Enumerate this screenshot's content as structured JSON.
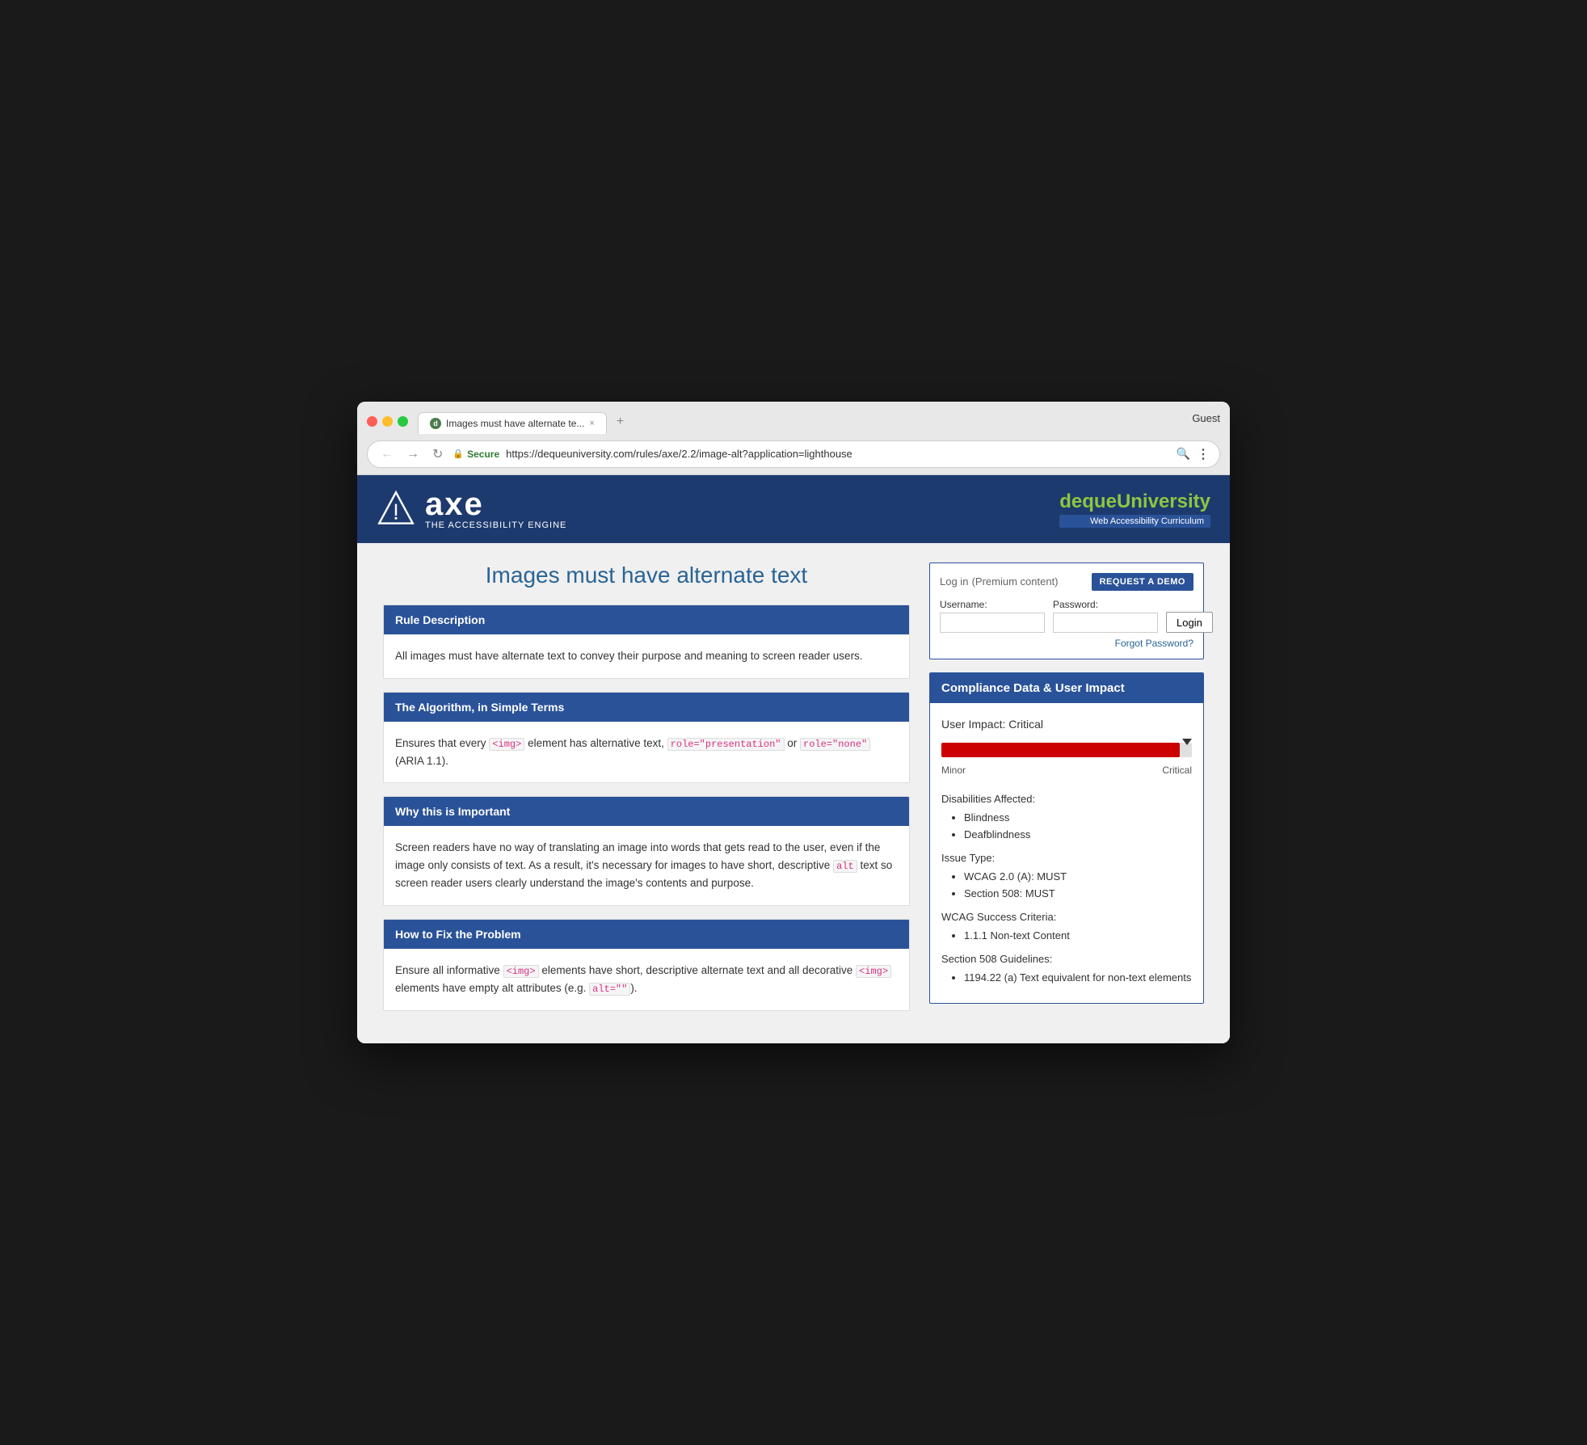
{
  "browser": {
    "tab_label": "Images must have alternate te...",
    "tab_favicon": "d",
    "guest_label": "Guest",
    "address_secure": "Secure",
    "address_url_full": "https://dequeuniversity.com/rules/axe/2.2/image-alt?application=lighthouse",
    "address_url_base": "https://dequeuniversity.com",
    "address_url_path": "/rules/axe/2.2/image-alt?application=lighthouse"
  },
  "header": {
    "axe_title": "axe",
    "axe_subtitle": "THE ACCESSIBILITY ENGINE",
    "deque_name_part1": "deque",
    "deque_name_part2": "University",
    "deque_tagline": "Web Accessibility Curriculum"
  },
  "page": {
    "title": "Images must have alternate text"
  },
  "login": {
    "title": "Log in",
    "subtitle": "(Premium content)",
    "request_demo_btn": "REQUEST A DEMO",
    "username_label": "Username:",
    "password_label": "Password:",
    "login_btn": "Login",
    "forgot_password": "Forgot Password?"
  },
  "compliance": {
    "panel_title": "Compliance Data & User Impact",
    "user_impact_label": "User Impact: Critical",
    "impact_min_label": "Minor",
    "impact_max_label": "Critical",
    "disabilities_title": "Disabilities Affected:",
    "disabilities": [
      "Blindness",
      "Deafblindness"
    ],
    "issue_type_title": "Issue Type:",
    "issue_types": [
      "WCAG 2.0 (A): MUST",
      "Section 508: MUST"
    ],
    "wcag_title": "WCAG Success Criteria:",
    "wcag_items": [
      "1.1.1 Non-text Content"
    ],
    "section508_title": "Section 508 Guidelines:",
    "section508_items": [
      "1194.22 (a) Text equivalent for non-text elements"
    ]
  },
  "sections": [
    {
      "title": "Rule Description",
      "body_html": "All images must have alternate text to convey their purpose and meaning to screen reader users."
    },
    {
      "title": "The Algorithm, in Simple Terms",
      "body_html": "Ensures that every &lt;img&gt; element has alternative text, <code>role=\"presentation\"</code> or <code>role=\"none\"</code> (ARIA 1.1)."
    },
    {
      "title": "Why this is Important",
      "body_html": "Screen readers have no way of translating an image into words that gets read to the user, even if the image only consists of text. As a result, it's necessary for images to have short, descriptive <code>alt</code> text so screen reader users clearly understand the image's contents and purpose."
    },
    {
      "title": "How to Fix the Problem",
      "body_html": "Ensure all informative <code>&lt;img&gt;</code> elements have short, descriptive alternate text and all decorative <code>&lt;img&gt;</code> elements have empty alt attributes (e.g. <code>alt=\"\"</code>)."
    }
  ]
}
